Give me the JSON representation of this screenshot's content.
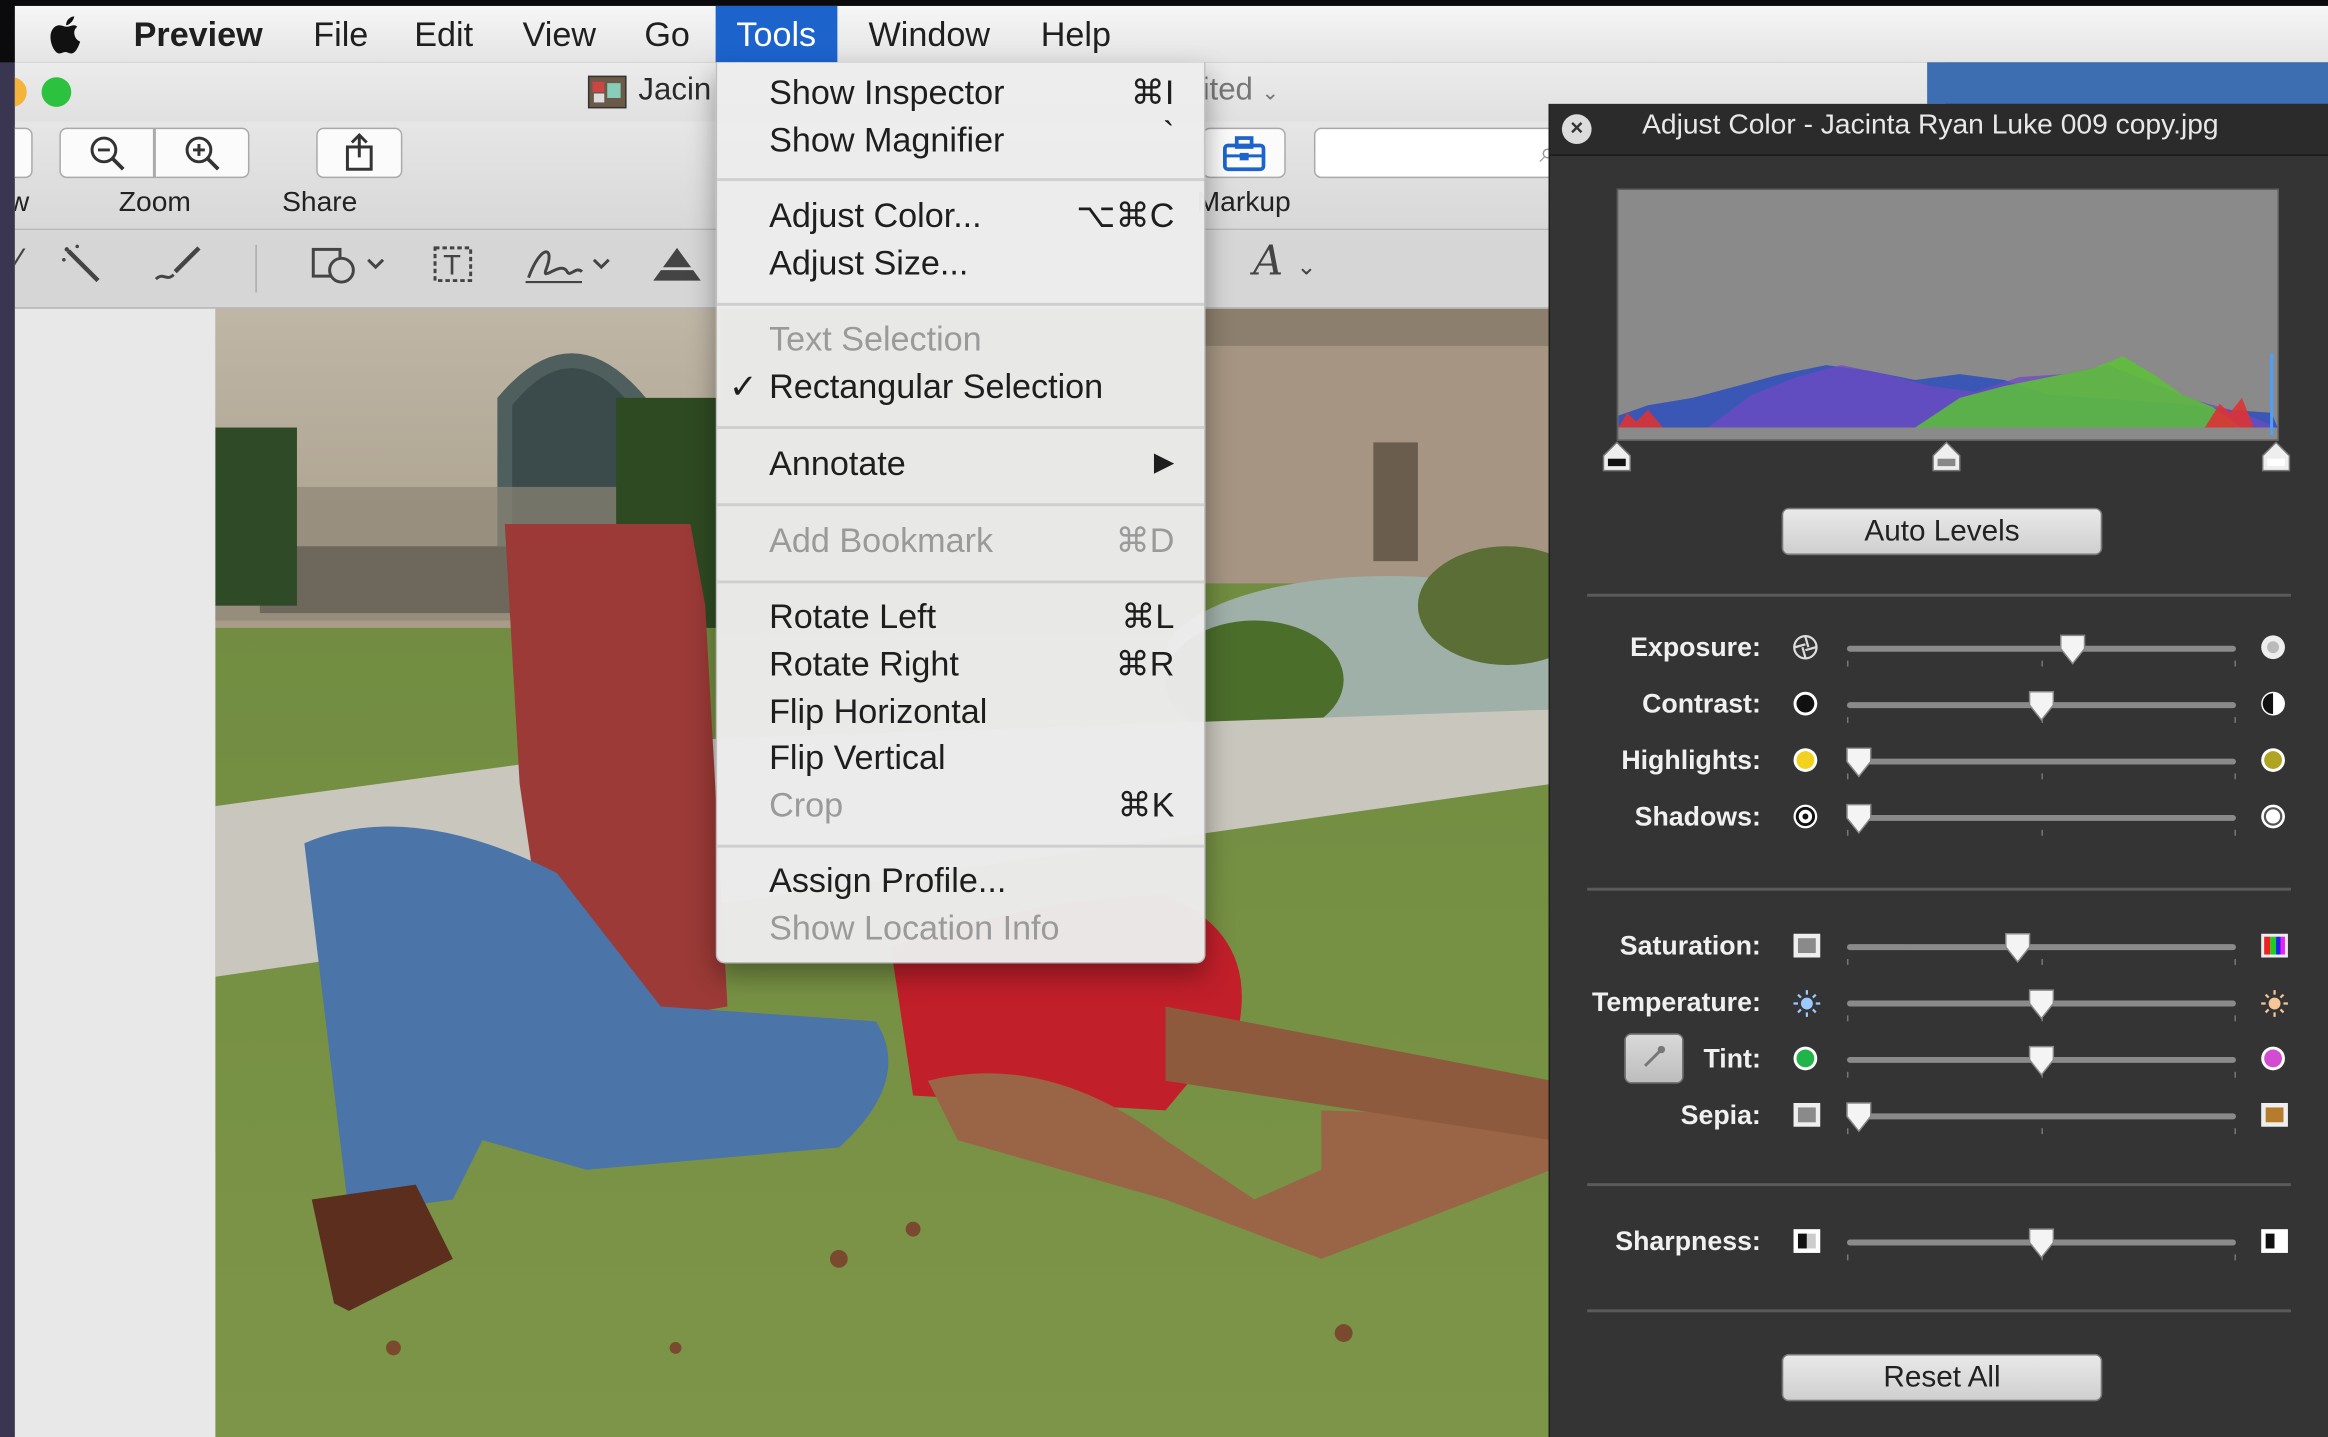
{
  "menubar": {
    "apple_icon": "apple-logo-icon",
    "items": [
      "Preview",
      "File",
      "Edit",
      "View",
      "Go",
      "Tools",
      "Window",
      "Help"
    ],
    "active": "Tools"
  },
  "window": {
    "doc_title": "Jacin",
    "edited": "ited",
    "toolbar": {
      "zoom_label": "Zoom",
      "share_label": "Share",
      "markup_label": "Markup",
      "left_partial": "w"
    }
  },
  "tools_menu": {
    "groups": [
      [
        {
          "label": "Show Inspector",
          "shortcut": "⌘I",
          "enabled": true
        },
        {
          "label": "Show Magnifier",
          "shortcut": "`",
          "enabled": true
        }
      ],
      [
        {
          "label": "Adjust Color...",
          "shortcut": "⌥⌘C",
          "enabled": true
        },
        {
          "label": "Adjust Size...",
          "shortcut": "",
          "enabled": true
        }
      ],
      [
        {
          "label": "Text Selection",
          "shortcut": "",
          "enabled": false
        },
        {
          "label": "Rectangular Selection",
          "shortcut": "",
          "enabled": true,
          "checked": true
        }
      ],
      [
        {
          "label": "Annotate",
          "shortcut": "▶",
          "enabled": true
        }
      ],
      [
        {
          "label": "Add Bookmark",
          "shortcut": "⌘D",
          "enabled": false
        }
      ],
      [
        {
          "label": "Rotate Left",
          "shortcut": "⌘L",
          "enabled": true
        },
        {
          "label": "Rotate Right",
          "shortcut": "⌘R",
          "enabled": true
        },
        {
          "label": "Flip Horizontal",
          "shortcut": "",
          "enabled": true
        },
        {
          "label": "Flip Vertical",
          "shortcut": "",
          "enabled": true
        },
        {
          "label": "Crop",
          "shortcut": "⌘K",
          "enabled": false
        }
      ],
      [
        {
          "label": "Assign Profile...",
          "shortcut": "",
          "enabled": true
        },
        {
          "label": "Show Location Info",
          "shortcut": "",
          "enabled": false
        }
      ]
    ]
  },
  "adjust_panel": {
    "title": "Adjust Color - Jacinta Ryan Luke 009 copy.jpg",
    "auto_levels": "Auto Levels",
    "reset_all": "Reset All",
    "sliders": [
      {
        "label": "Exposure:",
        "value": 0.58
      },
      {
        "label": "Contrast:",
        "value": 0.5
      },
      {
        "label": "Highlights:",
        "value": 0.03
      },
      {
        "label": "Shadows:",
        "value": 0.03
      },
      {
        "label": "Saturation:",
        "value": 0.44
      },
      {
        "label": "Temperature:",
        "value": 0.5
      },
      {
        "label": "Tint:",
        "value": 0.5
      },
      {
        "label": "Sepia:",
        "value": 0.03
      },
      {
        "label": "Sharpness:",
        "value": 0.5
      }
    ],
    "levels": {
      "black": 0.0,
      "mid": 0.5,
      "white": 1.0
    }
  }
}
